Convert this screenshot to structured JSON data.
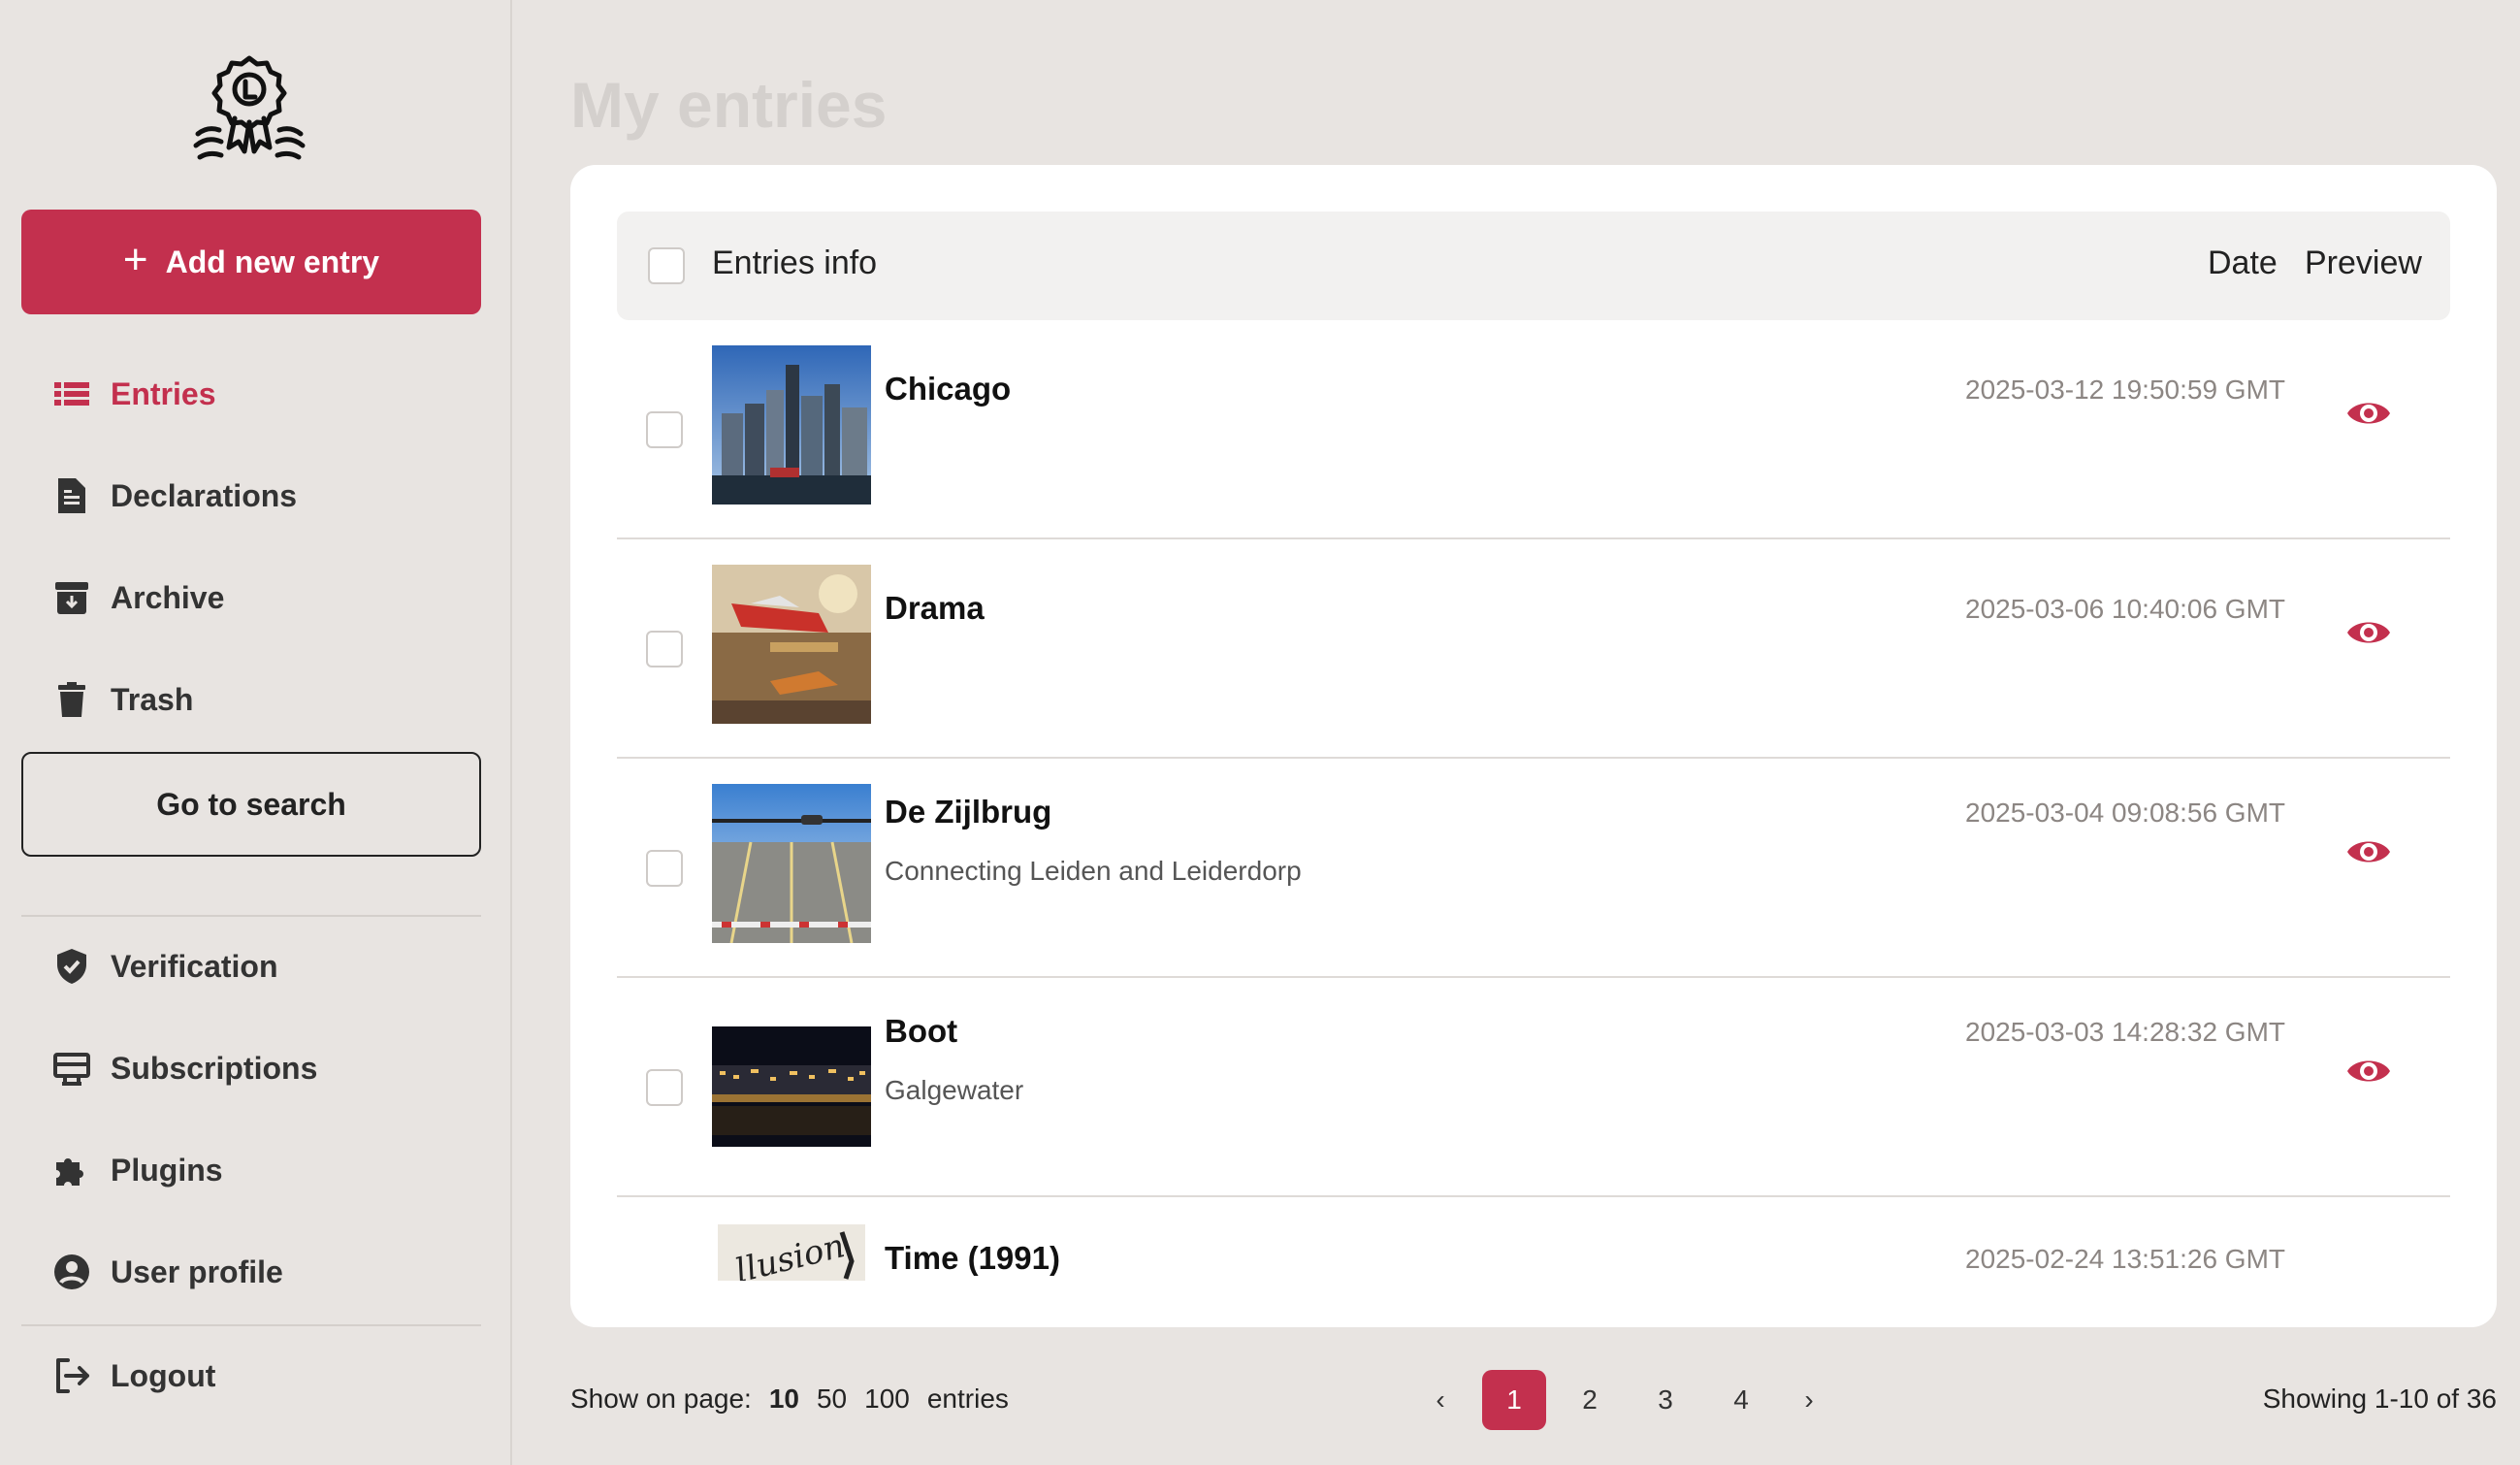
{
  "sidebar": {
    "add_button": "Add new entry",
    "items": [
      {
        "label": "Entries",
        "icon": "list-icon",
        "active": true
      },
      {
        "label": "Declarations",
        "icon": "document-icon"
      },
      {
        "label": "Archive",
        "icon": "archive-icon"
      },
      {
        "label": "Trash",
        "icon": "trash-icon"
      }
    ],
    "search_button": "Go to search",
    "items2": [
      {
        "label": "Verification",
        "icon": "shield-check-icon"
      },
      {
        "label": "Subscriptions",
        "icon": "subscriptions-icon"
      },
      {
        "label": "Plugins",
        "icon": "puzzle-icon"
      },
      {
        "label": "User profile",
        "icon": "user-circle-icon"
      }
    ],
    "logout": "Logout"
  },
  "main": {
    "title": "My entries",
    "table": {
      "headers": {
        "info": "Entries info",
        "date": "Date",
        "preview": "Preview"
      },
      "rows": [
        {
          "title": "Chicago",
          "subtitle": "",
          "date": "2025-03-12 19:50:59 GMT"
        },
        {
          "title": "Drama",
          "subtitle": "",
          "date": "2025-03-06 10:40:06 GMT"
        },
        {
          "title": "De Zijlbrug",
          "subtitle": "Connecting Leiden and Leiderdorp",
          "date": "2025-03-04 09:08:56 GMT"
        },
        {
          "title": "Boot",
          "subtitle": "Galgewater",
          "date": "2025-03-03 14:28:32 GMT"
        },
        {
          "title": "Time (1991)",
          "subtitle": "",
          "date": "2025-02-24 13:51:26 GMT"
        }
      ]
    }
  },
  "footer": {
    "show_on_page": "Show on page:",
    "options": [
      "10",
      "50",
      "100"
    ],
    "entries_label": "entries",
    "pages": [
      "1",
      "2",
      "3",
      "4"
    ],
    "prev": "‹",
    "next": "›",
    "showing": "Showing 1-10 of 36"
  },
  "colors": {
    "accent": "#c3304e",
    "background": "#e8e4e1"
  }
}
